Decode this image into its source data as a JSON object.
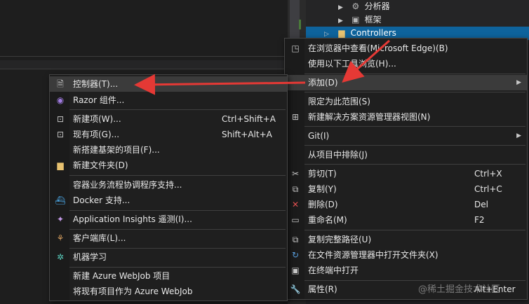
{
  "solution_explorer": {
    "items": [
      {
        "label": "分析器",
        "icon": "analyzer-icon"
      },
      {
        "label": "框架",
        "icon": "framework-icon"
      },
      {
        "label": "Controllers",
        "icon": "folder-icon"
      }
    ]
  },
  "context_menu": {
    "items": {
      "view_in_browser": "在浏览器中查看(Microsoft Edge)(B)",
      "browse_with": "使用以下工具浏览(H)...",
      "add": "添加(D)",
      "scope_to_this": "限定为此范围(S)",
      "new_solution_view": "新建解决方案资源管理器视图(N)",
      "git": "Git(I)",
      "exclude_from_project": "从项目中排除(J)",
      "cut": "剪切(T)",
      "cut_shortcut": "Ctrl+X",
      "copy": "复制(Y)",
      "copy_shortcut": "Ctrl+C",
      "delete": "删除(D)",
      "delete_shortcut": "Del",
      "rename": "重命名(M)",
      "rename_shortcut": "F2",
      "copy_full_path": "复制完整路径(U)",
      "open_in_explorer": "在文件资源管理器中打开文件夹(X)",
      "open_in_terminal": "在终端中打开",
      "properties": "属性(R)",
      "properties_shortcut": "Alt+Enter"
    }
  },
  "add_submenu": {
    "items": {
      "controller": "控制器(T)...",
      "razor_component": "Razor 组件...",
      "new_item": "新建项(W)...",
      "new_item_shortcut": "Ctrl+Shift+A",
      "existing_item": "现有项(G)...",
      "existing_item_shortcut": "Shift+Alt+A",
      "new_scaffolded_item": "新搭建基架的项目(F)...",
      "new_folder": "新建文件夹(D)",
      "container_orchestrator": "容器业务流程协调程序支持...",
      "docker_support": "Docker 支持...",
      "app_insights": "Application Insights 遥测(I)...",
      "client_library": "客户端库(L)...",
      "machine_learning": "机器学习",
      "new_webjob": "新建 Azure WebJob 项目",
      "existing_as_webjob": "将现有项目作为 Azure WebJob"
    }
  },
  "watermark": "@稀土掘金技术社区",
  "colors": {
    "selection": "#0e639c",
    "annotation_arrow": "#e53935",
    "delete_icon": "#e05050"
  }
}
